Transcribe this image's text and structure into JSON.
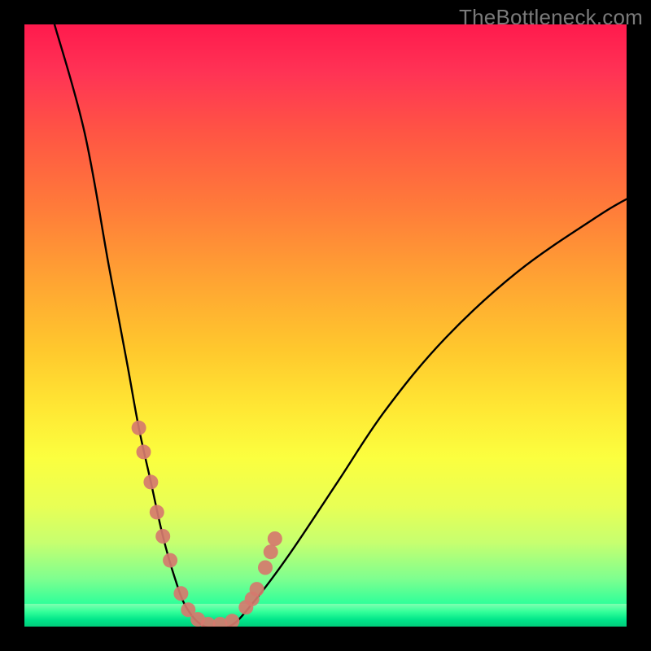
{
  "watermark": "TheBottleneck.com",
  "chart_data": {
    "type": "line",
    "title": "",
    "xlabel": "",
    "ylabel": "",
    "xlim": [
      0,
      100
    ],
    "ylim": [
      0,
      100
    ],
    "series": [
      {
        "name": "bottleneck-curve",
        "x": [
          5,
          10,
          14,
          17,
          19,
          21,
          23,
          25,
          27,
          30,
          34,
          38,
          44,
          52,
          60,
          70,
          82,
          95,
          100
        ],
        "values": [
          100,
          82,
          60,
          44,
          33,
          24,
          15,
          8,
          3,
          0,
          0,
          4,
          12,
          24,
          36,
          48,
          59,
          68,
          71
        ]
      }
    ],
    "markers": {
      "name": "highlight-dots",
      "color": "#d57a6e",
      "x": [
        19.0,
        19.8,
        21.0,
        22.0,
        23.0,
        24.2,
        26.0,
        27.2,
        28.8,
        30.5,
        32.5,
        34.5,
        36.8,
        37.8,
        38.6,
        40.0,
        40.9,
        41.6
      ],
      "values": [
        33.0,
        29.0,
        24.0,
        19.0,
        15.0,
        11.0,
        5.5,
        2.8,
        1.2,
        0.4,
        0.4,
        0.9,
        3.2,
        4.6,
        6.2,
        9.8,
        12.4,
        14.6
      ]
    },
    "gradient_stops": [
      {
        "pos": 0,
        "color": "#ff1a4d"
      },
      {
        "pos": 30,
        "color": "#ff7a3a"
      },
      {
        "pos": 64,
        "color": "#ffe834"
      },
      {
        "pos": 86,
        "color": "#c7ff6f"
      },
      {
        "pos": 100,
        "color": "#00e58a"
      }
    ]
  }
}
